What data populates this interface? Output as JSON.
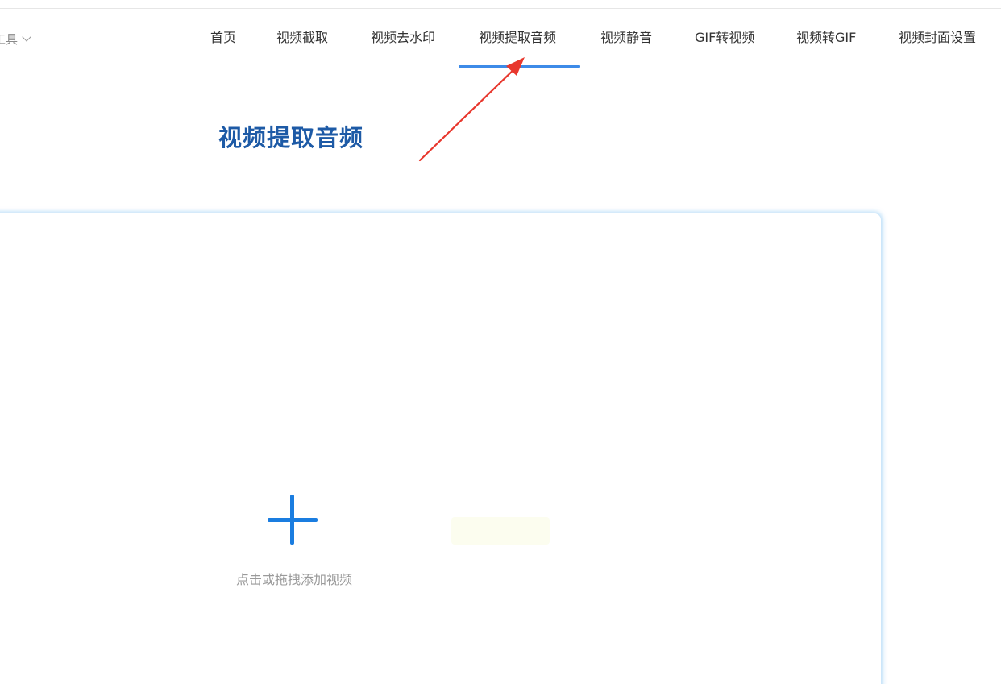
{
  "nav": {
    "tools_label": "工具",
    "items": [
      {
        "label": "首页"
      },
      {
        "label": "视频截取"
      },
      {
        "label": "视频去水印"
      },
      {
        "label": "视频提取音频",
        "active": true
      },
      {
        "label": "视频静音"
      },
      {
        "label": "GIF转视频"
      },
      {
        "label": "视频转GIF"
      },
      {
        "label": "视频封面设置"
      }
    ]
  },
  "page": {
    "title": "视频提取音频"
  },
  "upload": {
    "hint": "点击或拖拽添加视频",
    "icon": "plus-icon"
  },
  "colors": {
    "accent": "#1a7de0",
    "title": "#1d5aa6",
    "active_underline": "#3d8be8",
    "annotation_arrow": "#e8372d"
  }
}
